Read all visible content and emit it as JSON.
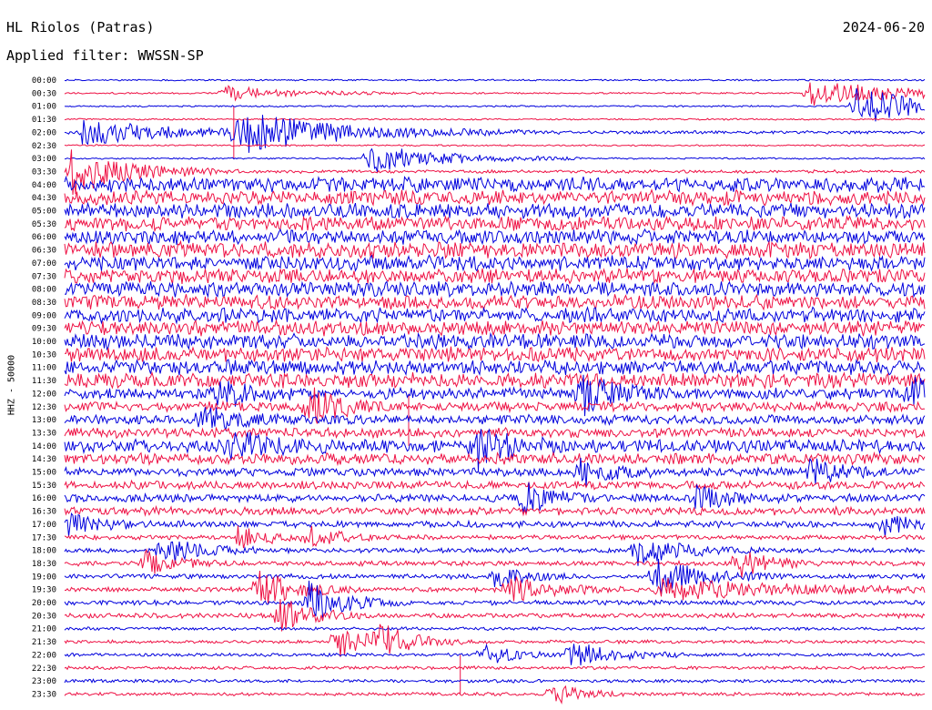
{
  "header": {
    "station": "HL Riolos (Patras)",
    "date": "2024-06-20",
    "filter": "Applied filter: WWSSN-SP"
  },
  "ylabel": "HHZ - 50000",
  "colors": {
    "trace_a": "#0000dd",
    "trace_b": "#ee1144",
    "text": "#000000",
    "background": "#ffffff"
  },
  "chart_data": {
    "type": "line",
    "title": "HL Riolos (Patras)",
    "subtitle": "Applied filter: WWSSN-SP",
    "xlabel": "",
    "ylabel": "HHZ - 50000",
    "grid": false,
    "legend": "none",
    "row_labels": [
      "00:00",
      "00:30",
      "01:00",
      "01:30",
      "02:00",
      "02:30",
      "03:00",
      "03:30",
      "04:00",
      "04:30",
      "05:00",
      "05:30",
      "06:00",
      "06:30",
      "07:00",
      "07:30",
      "08:00",
      "08:30",
      "09:00",
      "09:30",
      "10:00",
      "10:30",
      "11:00",
      "11:30",
      "12:00",
      "12:30",
      "13:00",
      "13:30",
      "14:00",
      "14:30",
      "15:00",
      "15:30",
      "16:00",
      "16:30",
      "17:00",
      "17:30",
      "18:00",
      "18:30",
      "19:00",
      "19:30",
      "20:00",
      "20:30",
      "21:00",
      "21:30",
      "22:00",
      "22:30",
      "23:00",
      "23:30"
    ],
    "noise_level": [
      1,
      1,
      1,
      1,
      2,
      1,
      1,
      2,
      9,
      9,
      9,
      9,
      9,
      10,
      9,
      9,
      9,
      9,
      9,
      9,
      9,
      9,
      9,
      9,
      7,
      6,
      6,
      6,
      8,
      7,
      5,
      5,
      5,
      5,
      4,
      3,
      3,
      3,
      3,
      3,
      3,
      3,
      2,
      2,
      2,
      2,
      2,
      2
    ],
    "events": [
      {
        "row": 1,
        "minute": 26.0,
        "amp": 14,
        "dur": 3.5
      },
      {
        "row": 1,
        "minute": 5.6,
        "amp": 8,
        "dur": 2.5
      },
      {
        "row": 2,
        "minute": 27.6,
        "amp": 24,
        "dur": 2.0
      },
      {
        "row": 4,
        "minute": 6.0,
        "amp": 22,
        "dur": 3.5
      },
      {
        "row": 4,
        "minute": 0.6,
        "amp": 14,
        "dur": 3.0
      },
      {
        "row": 6,
        "minute": 10.6,
        "amp": 16,
        "dur": 2.5
      },
      {
        "row": 7,
        "minute": 0.2,
        "amp": 26,
        "dur": 2.0
      },
      {
        "row": 24,
        "minute": 5.3,
        "amp": 18,
        "dur": 1.0
      },
      {
        "row": 24,
        "minute": 18.0,
        "amp": 22,
        "dur": 1.0
      },
      {
        "row": 24,
        "minute": 29.5,
        "amp": 16,
        "dur": 1.0
      },
      {
        "row": 25,
        "minute": 8.5,
        "amp": 22,
        "dur": 1.0
      },
      {
        "row": 26,
        "minute": 4.8,
        "amp": 14,
        "dur": 1.0
      },
      {
        "row": 28,
        "minute": 14.3,
        "amp": 24,
        "dur": 1.2
      },
      {
        "row": 28,
        "minute": 5.8,
        "amp": 16,
        "dur": 1.2
      },
      {
        "row": 30,
        "minute": 18.0,
        "amp": 16,
        "dur": 1.0
      },
      {
        "row": 30,
        "minute": 26.0,
        "amp": 14,
        "dur": 1.0
      },
      {
        "row": 32,
        "minute": 16.0,
        "amp": 16,
        "dur": 1.0
      },
      {
        "row": 32,
        "minute": 22.0,
        "amp": 14,
        "dur": 1.0
      },
      {
        "row": 34,
        "minute": 0.1,
        "amp": 14,
        "dur": 1.0
      },
      {
        "row": 34,
        "minute": 28.6,
        "amp": 12,
        "dur": 1.0
      },
      {
        "row": 35,
        "minute": 6.0,
        "amp": 12,
        "dur": 1.2
      },
      {
        "row": 35,
        "minute": 8.6,
        "amp": 10,
        "dur": 1.0
      },
      {
        "row": 36,
        "minute": 3.4,
        "amp": 18,
        "dur": 1.2
      },
      {
        "row": 36,
        "minute": 20.0,
        "amp": 16,
        "dur": 1.5
      },
      {
        "row": 37,
        "minute": 2.8,
        "amp": 14,
        "dur": 1.0
      },
      {
        "row": 37,
        "minute": 23.5,
        "amp": 18,
        "dur": 1.0
      },
      {
        "row": 38,
        "minute": 20.6,
        "amp": 22,
        "dur": 1.5
      },
      {
        "row": 38,
        "minute": 15.0,
        "amp": 12,
        "dur": 1.0
      },
      {
        "row": 39,
        "minute": 6.8,
        "amp": 22,
        "dur": 1.2
      },
      {
        "row": 39,
        "minute": 15.5,
        "amp": 14,
        "dur": 1.5
      },
      {
        "row": 39,
        "minute": 20.8,
        "amp": 12,
        "dur": 4.0
      },
      {
        "row": 40,
        "minute": 8.5,
        "amp": 22,
        "dur": 1.2
      },
      {
        "row": 41,
        "minute": 7.5,
        "amp": 20,
        "dur": 1.0
      },
      {
        "row": 43,
        "minute": 9.5,
        "amp": 20,
        "dur": 1.0
      },
      {
        "row": 43,
        "minute": 11.0,
        "amp": 18,
        "dur": 1.2
      },
      {
        "row": 44,
        "minute": 14.6,
        "amp": 12,
        "dur": 1.0
      },
      {
        "row": 44,
        "minute": 17.5,
        "amp": 16,
        "dur": 1.5
      },
      {
        "row": 47,
        "minute": 17.0,
        "amp": 12,
        "dur": 1.0
      }
    ],
    "bleed_lines": [
      {
        "minute": 13.8,
        "from_row": 44,
        "to_row": 47
      },
      {
        "minute": 12.0,
        "from_row": 24,
        "to_row": 28
      },
      {
        "minute": 5.9,
        "from_row": 2,
        "to_row": 6
      }
    ]
  }
}
